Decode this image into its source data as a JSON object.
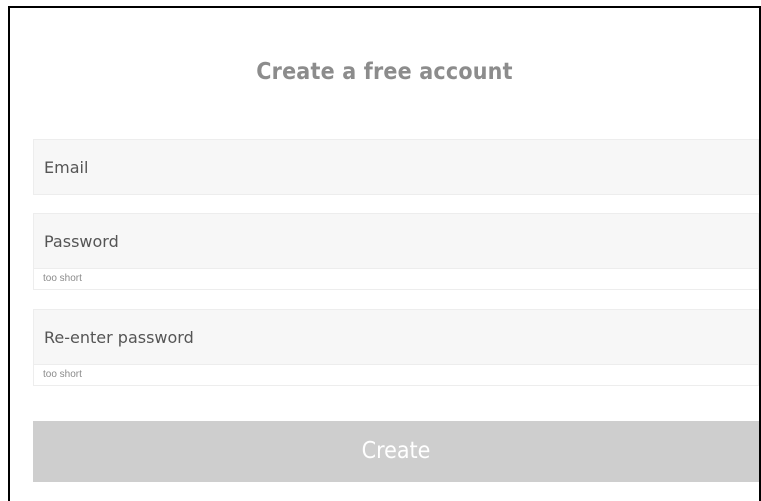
{
  "form": {
    "title": "Create a free account",
    "email_placeholder": "Email",
    "password_placeholder": "Password",
    "password_hint": "too short",
    "repassword_placeholder": "Re-enter password",
    "repassword_hint": "too short",
    "create_label": "Create"
  },
  "colors": {
    "title_text": "#8c8c8c",
    "field_background": "#f7f7f7",
    "button_background": "#cecece",
    "button_text": "#ffffff"
  }
}
